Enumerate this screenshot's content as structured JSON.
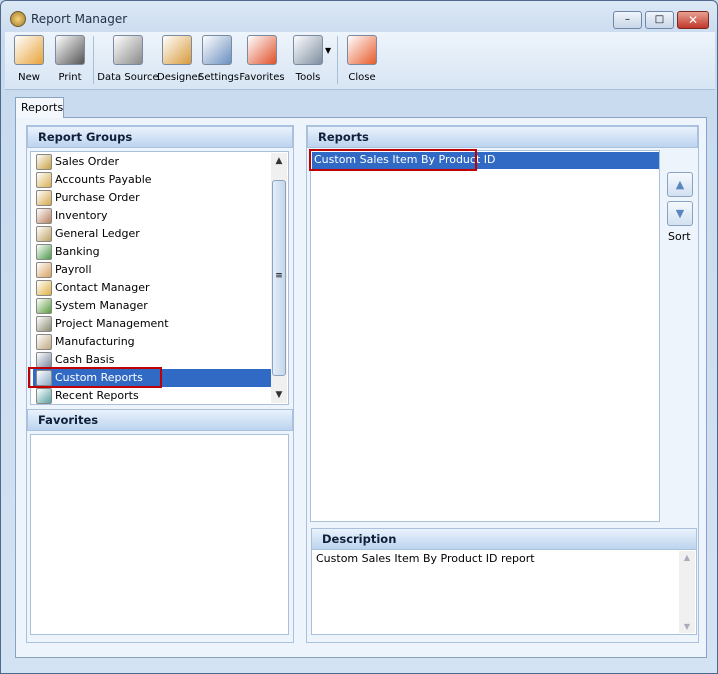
{
  "window": {
    "title": "Report Manager",
    "minimize": "–",
    "maximize": "□",
    "close": "✕"
  },
  "toolbar": {
    "items": [
      {
        "label": "New",
        "icon": "new-report-icon",
        "color": "#e8a33a"
      },
      {
        "label": "Print",
        "icon": "printer-icon",
        "color": "#555555"
      },
      {
        "label": "Data Source",
        "icon": "database-icon",
        "color": "#8a8a8a"
      },
      {
        "label": "Designer",
        "icon": "designer-ruler-icon",
        "color": "#d89a3a"
      },
      {
        "label": "Settings",
        "icon": "settings-sliders-icon",
        "color": "#6b8fbf"
      },
      {
        "label": "Favorites",
        "icon": "favorites-heart-icon",
        "color": "#e0502a"
      },
      {
        "label": "Tools",
        "icon": "tools-icon",
        "color": "#7d8da0"
      },
      {
        "label": "Close",
        "icon": "close-window-icon",
        "color": "#e85a2a"
      }
    ],
    "tools_dropdown": "▼"
  },
  "tabs": [
    {
      "label": "Reports",
      "active": true
    }
  ],
  "report_groups": {
    "title": "Report Groups",
    "items": [
      {
        "label": "Sales Order",
        "icon": "sales-order-icon",
        "color": "#c8a040"
      },
      {
        "label": "Accounts Payable",
        "icon": "accounts-payable-icon",
        "color": "#d8b050"
      },
      {
        "label": "Purchase Order",
        "icon": "purchase-order-icon",
        "color": "#d4a84a"
      },
      {
        "label": "Inventory",
        "icon": "inventory-icon",
        "color": "#b88060"
      },
      {
        "label": "General Ledger",
        "icon": "general-ledger-icon",
        "color": "#c0a060"
      },
      {
        "label": "Banking",
        "icon": "banking-icon",
        "color": "#4a9a4a"
      },
      {
        "label": "Payroll",
        "icon": "payroll-icon",
        "color": "#d8a060"
      },
      {
        "label": "Contact Manager",
        "icon": "contact-manager-icon",
        "color": "#e0b040"
      },
      {
        "label": "System Manager",
        "icon": "system-manager-icon",
        "color": "#5a9a3a"
      },
      {
        "label": "Project Management",
        "icon": "project-management-icon",
        "color": "#8a8a70"
      },
      {
        "label": "Manufacturing",
        "icon": "manufacturing-icon",
        "color": "#c0a880"
      },
      {
        "label": "Cash Basis",
        "icon": "cash-basis-icon",
        "color": "#7a8aa0"
      },
      {
        "label": "Custom Reports",
        "icon": "custom-reports-icon",
        "color": "#8aa8c8",
        "selected": true
      },
      {
        "label": "Recent Reports",
        "icon": "recent-reports-icon",
        "color": "#5aa0a0"
      }
    ]
  },
  "favorites": {
    "title": "Favorites",
    "items": []
  },
  "reports": {
    "title": "Reports",
    "items": [
      {
        "label": "Custom Sales Item By Product ID",
        "selected": true
      }
    ],
    "sort_label": "Sort",
    "sort_up": "▲",
    "sort_down": "▼"
  },
  "description": {
    "title": "Description",
    "text": "Custom Sales Item By Product ID report"
  },
  "colors": {
    "selection": "#316ac5",
    "highlight_border": "#c00000"
  }
}
